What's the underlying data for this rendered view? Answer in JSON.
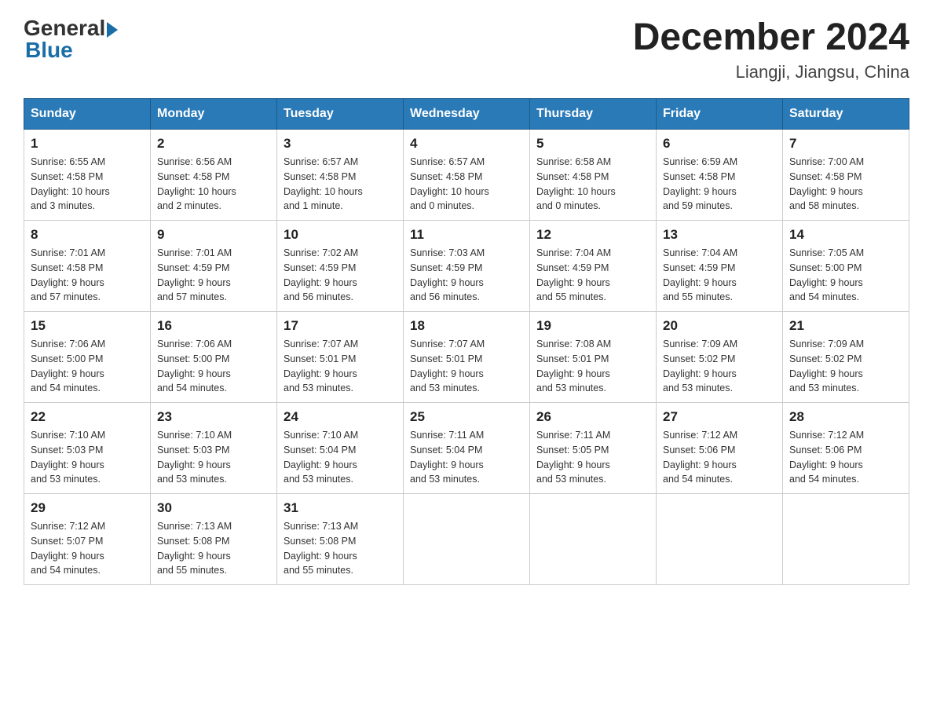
{
  "header": {
    "logo_general": "General",
    "logo_blue": "Blue",
    "month_year": "December 2024",
    "location": "Liangji, Jiangsu, China"
  },
  "days_of_week": [
    "Sunday",
    "Monday",
    "Tuesday",
    "Wednesday",
    "Thursday",
    "Friday",
    "Saturday"
  ],
  "weeks": [
    [
      {
        "day": "1",
        "sunrise": "Sunrise: 6:55 AM",
        "sunset": "Sunset: 4:58 PM",
        "daylight": "Daylight: 10 hours",
        "minutes": "and 3 minutes."
      },
      {
        "day": "2",
        "sunrise": "Sunrise: 6:56 AM",
        "sunset": "Sunset: 4:58 PM",
        "daylight": "Daylight: 10 hours",
        "minutes": "and 2 minutes."
      },
      {
        "day": "3",
        "sunrise": "Sunrise: 6:57 AM",
        "sunset": "Sunset: 4:58 PM",
        "daylight": "Daylight: 10 hours",
        "minutes": "and 1 minute."
      },
      {
        "day": "4",
        "sunrise": "Sunrise: 6:57 AM",
        "sunset": "Sunset: 4:58 PM",
        "daylight": "Daylight: 10 hours",
        "minutes": "and 0 minutes."
      },
      {
        "day": "5",
        "sunrise": "Sunrise: 6:58 AM",
        "sunset": "Sunset: 4:58 PM",
        "daylight": "Daylight: 10 hours",
        "minutes": "and 0 minutes."
      },
      {
        "day": "6",
        "sunrise": "Sunrise: 6:59 AM",
        "sunset": "Sunset: 4:58 PM",
        "daylight": "Daylight: 9 hours",
        "minutes": "and 59 minutes."
      },
      {
        "day": "7",
        "sunrise": "Sunrise: 7:00 AM",
        "sunset": "Sunset: 4:58 PM",
        "daylight": "Daylight: 9 hours",
        "minutes": "and 58 minutes."
      }
    ],
    [
      {
        "day": "8",
        "sunrise": "Sunrise: 7:01 AM",
        "sunset": "Sunset: 4:58 PM",
        "daylight": "Daylight: 9 hours",
        "minutes": "and 57 minutes."
      },
      {
        "day": "9",
        "sunrise": "Sunrise: 7:01 AM",
        "sunset": "Sunset: 4:59 PM",
        "daylight": "Daylight: 9 hours",
        "minutes": "and 57 minutes."
      },
      {
        "day": "10",
        "sunrise": "Sunrise: 7:02 AM",
        "sunset": "Sunset: 4:59 PM",
        "daylight": "Daylight: 9 hours",
        "minutes": "and 56 minutes."
      },
      {
        "day": "11",
        "sunrise": "Sunrise: 7:03 AM",
        "sunset": "Sunset: 4:59 PM",
        "daylight": "Daylight: 9 hours",
        "minutes": "and 56 minutes."
      },
      {
        "day": "12",
        "sunrise": "Sunrise: 7:04 AM",
        "sunset": "Sunset: 4:59 PM",
        "daylight": "Daylight: 9 hours",
        "minutes": "and 55 minutes."
      },
      {
        "day": "13",
        "sunrise": "Sunrise: 7:04 AM",
        "sunset": "Sunset: 4:59 PM",
        "daylight": "Daylight: 9 hours",
        "minutes": "and 55 minutes."
      },
      {
        "day": "14",
        "sunrise": "Sunrise: 7:05 AM",
        "sunset": "Sunset: 5:00 PM",
        "daylight": "Daylight: 9 hours",
        "minutes": "and 54 minutes."
      }
    ],
    [
      {
        "day": "15",
        "sunrise": "Sunrise: 7:06 AM",
        "sunset": "Sunset: 5:00 PM",
        "daylight": "Daylight: 9 hours",
        "minutes": "and 54 minutes."
      },
      {
        "day": "16",
        "sunrise": "Sunrise: 7:06 AM",
        "sunset": "Sunset: 5:00 PM",
        "daylight": "Daylight: 9 hours",
        "minutes": "and 54 minutes."
      },
      {
        "day": "17",
        "sunrise": "Sunrise: 7:07 AM",
        "sunset": "Sunset: 5:01 PM",
        "daylight": "Daylight: 9 hours",
        "minutes": "and 53 minutes."
      },
      {
        "day": "18",
        "sunrise": "Sunrise: 7:07 AM",
        "sunset": "Sunset: 5:01 PM",
        "daylight": "Daylight: 9 hours",
        "minutes": "and 53 minutes."
      },
      {
        "day": "19",
        "sunrise": "Sunrise: 7:08 AM",
        "sunset": "Sunset: 5:01 PM",
        "daylight": "Daylight: 9 hours",
        "minutes": "and 53 minutes."
      },
      {
        "day": "20",
        "sunrise": "Sunrise: 7:09 AM",
        "sunset": "Sunset: 5:02 PM",
        "daylight": "Daylight: 9 hours",
        "minutes": "and 53 minutes."
      },
      {
        "day": "21",
        "sunrise": "Sunrise: 7:09 AM",
        "sunset": "Sunset: 5:02 PM",
        "daylight": "Daylight: 9 hours",
        "minutes": "and 53 minutes."
      }
    ],
    [
      {
        "day": "22",
        "sunrise": "Sunrise: 7:10 AM",
        "sunset": "Sunset: 5:03 PM",
        "daylight": "Daylight: 9 hours",
        "minutes": "and 53 minutes."
      },
      {
        "day": "23",
        "sunrise": "Sunrise: 7:10 AM",
        "sunset": "Sunset: 5:03 PM",
        "daylight": "Daylight: 9 hours",
        "minutes": "and 53 minutes."
      },
      {
        "day": "24",
        "sunrise": "Sunrise: 7:10 AM",
        "sunset": "Sunset: 5:04 PM",
        "daylight": "Daylight: 9 hours",
        "minutes": "and 53 minutes."
      },
      {
        "day": "25",
        "sunrise": "Sunrise: 7:11 AM",
        "sunset": "Sunset: 5:04 PM",
        "daylight": "Daylight: 9 hours",
        "minutes": "and 53 minutes."
      },
      {
        "day": "26",
        "sunrise": "Sunrise: 7:11 AM",
        "sunset": "Sunset: 5:05 PM",
        "daylight": "Daylight: 9 hours",
        "minutes": "and 53 minutes."
      },
      {
        "day": "27",
        "sunrise": "Sunrise: 7:12 AM",
        "sunset": "Sunset: 5:06 PM",
        "daylight": "Daylight: 9 hours",
        "minutes": "and 54 minutes."
      },
      {
        "day": "28",
        "sunrise": "Sunrise: 7:12 AM",
        "sunset": "Sunset: 5:06 PM",
        "daylight": "Daylight: 9 hours",
        "minutes": "and 54 minutes."
      }
    ],
    [
      {
        "day": "29",
        "sunrise": "Sunrise: 7:12 AM",
        "sunset": "Sunset: 5:07 PM",
        "daylight": "Daylight: 9 hours",
        "minutes": "and 54 minutes."
      },
      {
        "day": "30",
        "sunrise": "Sunrise: 7:13 AM",
        "sunset": "Sunset: 5:08 PM",
        "daylight": "Daylight: 9 hours",
        "minutes": "and 55 minutes."
      },
      {
        "day": "31",
        "sunrise": "Sunrise: 7:13 AM",
        "sunset": "Sunset: 5:08 PM",
        "daylight": "Daylight: 9 hours",
        "minutes": "and 55 minutes."
      },
      null,
      null,
      null,
      null
    ]
  ]
}
